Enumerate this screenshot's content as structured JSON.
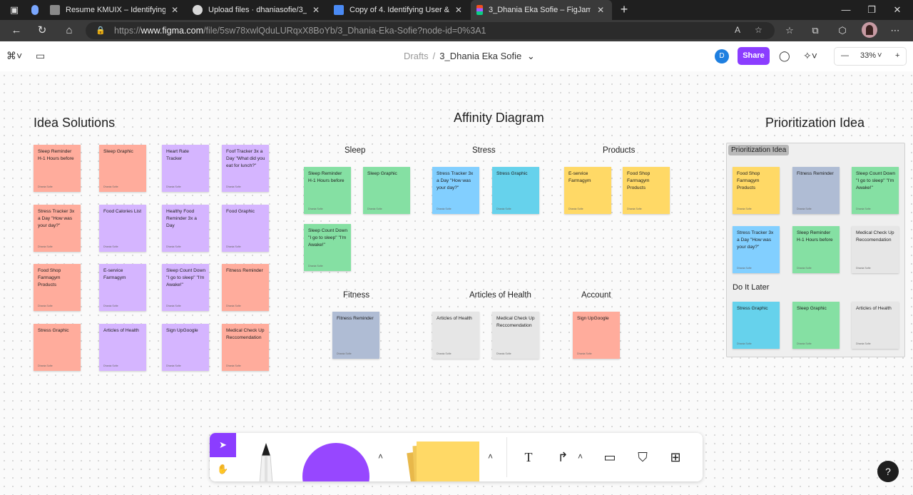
{
  "tabs": [
    {
      "title": "Resume KMUIX – Identifying Use",
      "icon": "docs-icon"
    },
    {
      "title": "Upload files · dhaniasofie/3_UIU",
      "icon": "github-icon"
    },
    {
      "title": "Copy of 4. Identifying User & De",
      "icon": "docs-icon"
    },
    {
      "title": "3_Dhania Eka Sofie – FigJam",
      "icon": "figma-icon"
    }
  ],
  "url": {
    "prefix": "https://",
    "host": "www.figma.com",
    "path": "/file/5sw78xwlQduLURqxX8BoYb/3_Dhania-Eka-Sofie?node-id=0%3A1"
  },
  "figjam": {
    "crumb_drafts": "Drafts",
    "crumb_sep": "/",
    "file_name": "3_Dhania Eka Sofie",
    "avatar": "D",
    "share": "Share",
    "zoom": "33%"
  },
  "colors": {
    "accent": "#8b3dff",
    "avatar": "#1e7fe0"
  },
  "sections": {
    "idea_solutions": "Idea Solutions",
    "affinity": "Affinity Diagram",
    "prioritization": "Prioritization Idea",
    "sleep": "Sleep",
    "stress": "Stress",
    "products": "Products",
    "fitness": "Fitness",
    "articles": "Articles of Health",
    "account": "Account",
    "prio_label": "Prioritization Idea",
    "do_it_later": "Do It Later"
  },
  "author": "Dhania Sofie",
  "idea_notes": [
    [
      "Sleep Reminder H-1 Hours before",
      "Sleep Graphic",
      "Heart Rate Tracker",
      "Foof Tracker 3x a Day \"What did you eat for lunch?\""
    ],
    [
      "Stress Tracker 3x a Day \"How was your day?\"",
      "Food Calories List",
      "Healthy Food Reminder 3x a Day",
      "Food Graphic"
    ],
    [
      "Food Shop Farmagym Products",
      "E-service Farmagym",
      "Sleep Count Down \"I go to sleep\" \"I'm Awake!\"",
      "Fitness Reminder"
    ],
    [
      "Stress Graphic",
      "Articles of Health",
      "Sign UpGoogle",
      "Medical Check Up Reccomendation"
    ]
  ],
  "affinity_notes": {
    "sleep": [
      "Sleep Reminder H-1 Hours before",
      "Sleep Graphic",
      "Sleep Count Down \"I go to sleep\" \"I'm Awake!\""
    ],
    "stress": [
      "Stress Tracker 3x a Day \"How was your day?\"",
      "Stress Graphic"
    ],
    "products": [
      "E-service Farmagym",
      "Food Shop Farmagym Products"
    ],
    "fitness": [
      "Fitness Reminder"
    ],
    "articles": [
      "Articles of Health",
      "Medical Check Up Reccomendation"
    ],
    "account": [
      "Sign UpGoogle"
    ]
  },
  "prio_notes": {
    "top": [
      "Food Shop Farmagym Products",
      "Fitness Reminder",
      "Sleep Count Down \"I go to sleep\" \"I'm Awake!\"",
      "Stress Tracker 3x a Day \"How was your day?\"",
      "Sleep Reminder H-1 Hours before",
      "Medical Check Up Reccomendation"
    ],
    "later": [
      "Stress Graphic",
      "Sleep Graphic",
      "Articles of Health"
    ]
  }
}
